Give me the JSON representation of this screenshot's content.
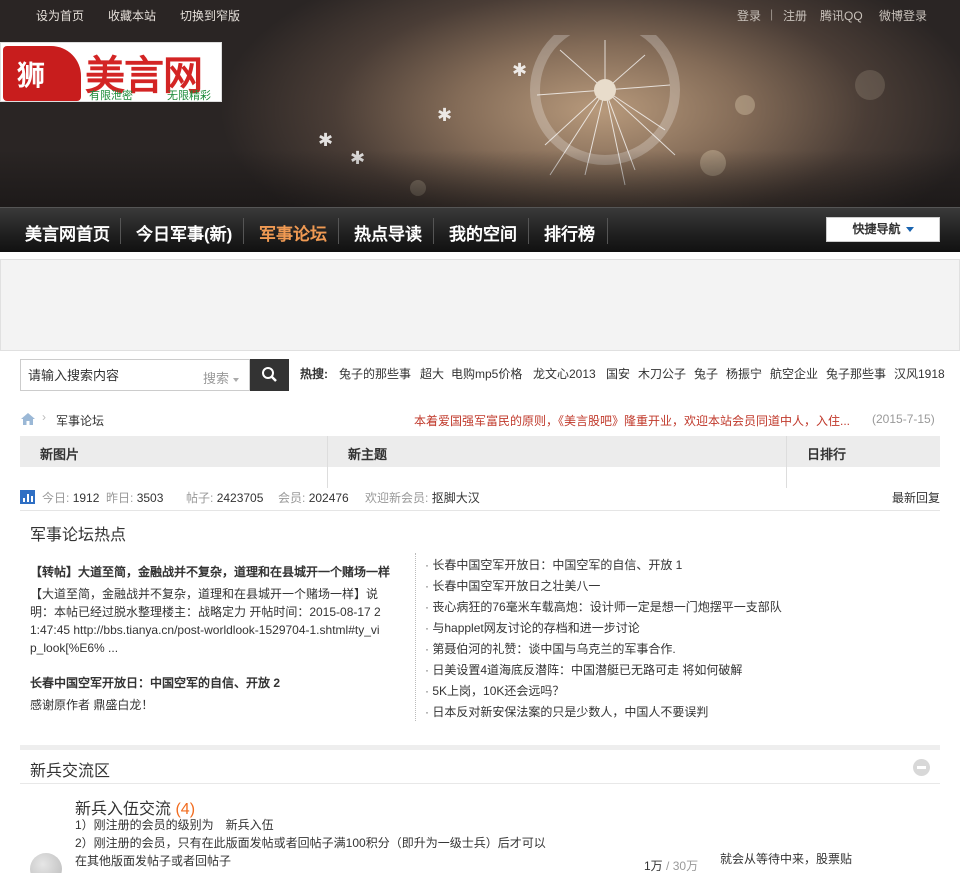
{
  "topbar": {
    "left": [
      "设为首页",
      "收藏本站",
      "切换到窄版"
    ],
    "login": "登录",
    "register": "注册",
    "qq_login": "腾讯QQ",
    "weibo_login": "微博登录"
  },
  "logo": {
    "name": "美言网",
    "slogan1": "有限泄密",
    "slogan2": "无限精彩"
  },
  "nav": {
    "items": [
      "美言网首页",
      "今日军事(新)",
      "军事论坛",
      "热点导读",
      "我的空间",
      "排行榜"
    ],
    "active_index": 2,
    "quick_nav": "快捷导航"
  },
  "search": {
    "placeholder": "请输入搜索内容",
    "type_label": "搜索",
    "hot_label": "热搜:",
    "hot_words": [
      "兔子的那些事",
      "超大",
      "电购mp5价格",
      "龙文心2013",
      "国安",
      "木刀公子",
      "兔子",
      "杨振宁",
      "航空企业",
      "兔子那些事",
      "汉风1918"
    ]
  },
  "breadcrumb": {
    "forum": "军事论坛",
    "notice": "本着爱国强军富民的原则，《美言股吧》隆重开业，欢迎本站会员同道中人，入住...",
    "notice_date": "(2015-7-15)"
  },
  "tabs": [
    "新图片",
    "新主题",
    "日排行"
  ],
  "stats": {
    "today_label": "今日:",
    "today": "1912",
    "yesterday_label": "昨日:",
    "yesterday": "3503",
    "posts_label": "帖子:",
    "posts": "2423705",
    "members_label": "会员:",
    "members": "202476",
    "welcome_label": "欢迎新会员:",
    "new_member": "抠脚大汉",
    "latest_reply": "最新回复"
  },
  "hot": {
    "title": "军事论坛热点",
    "post1_title": "【转帖】大道至简，金融战并不复杂，道理和在县城开一个赌场一样",
    "post1_body": "【大道至简，金融战并不复杂，道理和在县城开一个赌场一样】说明：本帖已经过脱水整理楼主：战略定力 开帖时间：2015-08-17 21:47:45 http://bbs.tianya.cn/post-worldlook-1529704-1.shtml#ty_vip_look[%E6% ...",
    "post2_title": "长春中国空军开放日：中国空军的自信、开放 2",
    "post2_body": "感谢原作者 鼎盛白龙！",
    "list": [
      "长春中国空军开放日：中国空军的自信、开放 1",
      "长春中国空军开放日之壮美八一",
      "丧心病狂的76毫米车载高炮：设计师一定是想一门炮摆平一支部队",
      "与happlet网友讨论的存档和进一步讨论",
      "第聂伯河的礼赞：谈中国与乌克兰的军事合作.",
      "日美设置4道海底反潜阵：中国潜艇已无路可走 将如何破解",
      "5K上岗，10K还会远吗？",
      "日本反对新安保法案的只是少数人，中国人不要误判"
    ]
  },
  "section": {
    "title": "新兵交流区",
    "forum_name": "新兵入伍交流",
    "forum_count": "(4)",
    "desc": [
      "1）刚注册的会员的级别为　新兵入伍",
      "2）刚注册的会员，只有在此版面发帖或者回帖子满100积分（即升为一级士兵）后才可以",
      "在其他版面发帖子或者回帖子"
    ],
    "threads": "1万",
    "slash": "/",
    "posts": "30万",
    "last_post": "就会从等待中来，股票贴"
  }
}
